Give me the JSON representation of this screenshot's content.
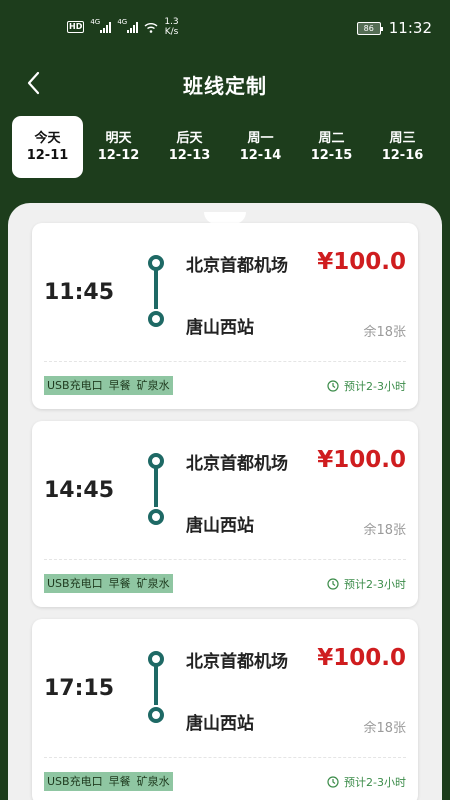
{
  "status_bar": {
    "hd": "HD",
    "net1": "4G",
    "net2": "4G",
    "speed_value": "1.3",
    "speed_unit": "K/s",
    "battery": "86",
    "time": "11:32"
  },
  "nav": {
    "title": "班线定制",
    "back_icon": "chevron-left-icon"
  },
  "day_tabs": [
    {
      "day": "今天",
      "date": "12-11",
      "active": true
    },
    {
      "day": "明天",
      "date": "12-12",
      "active": false
    },
    {
      "day": "后天",
      "date": "12-13",
      "active": false
    },
    {
      "day": "周一",
      "date": "12-14",
      "active": false
    },
    {
      "day": "周二",
      "date": "12-15",
      "active": false
    },
    {
      "day": "周三",
      "date": "12-16",
      "active": false
    }
  ],
  "trips": [
    {
      "time": "11:45",
      "from": "北京首都机场",
      "to": "唐山西站",
      "price": "¥100.0",
      "seats": "余18张",
      "tags": [
        "USB充电口",
        "早餐",
        "矿泉水"
      ],
      "duration": "预计2-3小时"
    },
    {
      "time": "14:45",
      "from": "北京首都机场",
      "to": "唐山西站",
      "price": "¥100.0",
      "seats": "余18张",
      "tags": [
        "USB充电口",
        "早餐",
        "矿泉水"
      ],
      "duration": "预计2-3小时"
    },
    {
      "time": "17:15",
      "from": "北京首都机场",
      "to": "唐山西站",
      "price": "¥100.0",
      "seats": "余18张",
      "tags": [
        "USB充电口",
        "早餐",
        "矿泉水"
      ],
      "duration": "预计2-3小时"
    }
  ],
  "colors": {
    "header_bg": "#1d3d1c",
    "route": "#1e6965",
    "price": "#cf1d1f",
    "tag_bg": "#8fc6a2",
    "duration": "#3c8c4a"
  }
}
